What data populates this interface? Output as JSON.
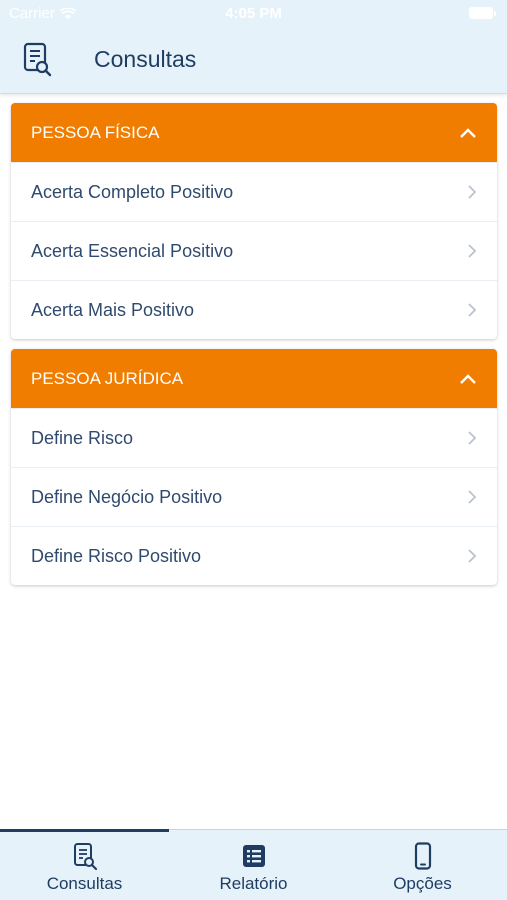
{
  "status_bar": {
    "carrier": "Carrier",
    "time": "4:05 PM"
  },
  "header": {
    "title": "Consultas",
    "icon": "document-search-icon"
  },
  "sections": [
    {
      "title": "PESSOA FÍSICA",
      "items": [
        {
          "label": "Acerta Completo Positivo"
        },
        {
          "label": "Acerta Essencial Positivo"
        },
        {
          "label": "Acerta Mais Positivo"
        }
      ]
    },
    {
      "title": "PESSOA JURÍDICA",
      "items": [
        {
          "label": "Define Risco"
        },
        {
          "label": "Define Negócio Positivo"
        },
        {
          "label": "Define Risco Positivo"
        }
      ]
    }
  ],
  "tab_bar": {
    "tabs": [
      {
        "label": "Consultas",
        "icon": "document-search-icon",
        "selected": true
      },
      {
        "label": "Relatório",
        "icon": "list-icon",
        "selected": false
      },
      {
        "label": "Opções",
        "icon": "phone-icon",
        "selected": false
      }
    ]
  },
  "colors": {
    "accent_orange": "#f07d00",
    "navy_text": "#1f3d63",
    "bar_background": "#e6f2f9"
  }
}
